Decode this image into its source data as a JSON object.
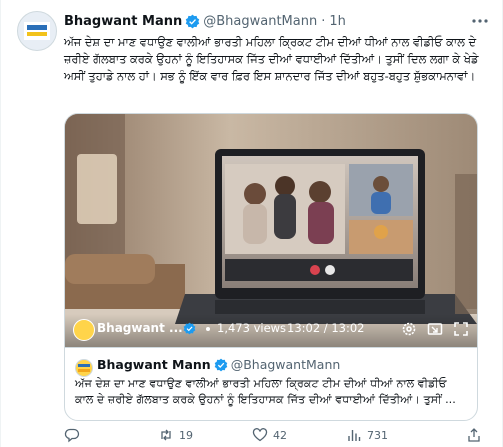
{
  "tweet": {
    "author_name": "Bhagwant Mann",
    "handle": "@BhagwantMann",
    "separator": "·",
    "time": "1h",
    "text": "ਅੱਜ ਦੇਸ਼ ਦਾ ਮਾਣ ਵਧਾਉਣ ਵਾਲੀਆਂ ਭਾਰਤੀ ਮਹਿਲਾ ਕ੍ਰਿਕਟ ਟੀਮ ਦੀਆਂ ਧੀਆਂ ਨਾਲ ਵੀਡੀਓ ਕਾਲ ਦੇ ਜ਼ਰੀਏ ਗੱਲਬਾਤ ਕਰਕੇ ਉਹਨਾਂ ਨੂੰ ਇਤਿਹਾਸਕ ਜਿੱਤ ਦੀਆਂ ਵਧਾਈਆਂ ਦਿੱਤੀਆਂ। ਤੁਸੀਂ ਦਿਲ ਲਗਾ ਕੇ ਖੇਡੇ ਅਸੀਂ ਤੁਹਾਡੇ ਨਾਲ ਹਾਂ। ਸਭ ਨੂੰ ਇੱਕ ਵਾਰ ਫ਼ਿਰ ਇਸ ਸ਼ਾਨਦਾਰ ਜਿੱਤ ਦੀਆਂ ਬਹੁਤ-ਬਹੁਤ ਸ਼ੁੱਭਕਾਮਨਾਵਾਂ।"
  },
  "video": {
    "channel_name": "Bhagwant ...",
    "views": "1,473 views",
    "time": "13:02 / 13:02"
  },
  "quote": {
    "author_name": "Bhagwant Mann",
    "handle": "@BhagwantMann",
    "text": "ਅੱਜ ਦੇਸ਼ ਦਾ ਮਾਣ ਵਧਾਉਣ ਵਾਲੀਆਂ ਭਾਰਤੀ ਮਹਿਲਾ ਕ੍ਰਿਕਟ ਟੀਮ ਦੀਆਂ ਧੀਆਂ ਨਾਲ ਵੀਡੀਓ ਕਾਲ ਦੇ ਜ਼ਰੀਏ ਗੱਲਬਾਤ ਕਰਕੇ ਉਹਨਾਂ ਨੂੰ ਇਤਿਹਾਸਕ ਜਿੱਤ ਦੀਆਂ ਵਧਾਈਆਂ ਦਿੱਤੀਆਂ। ਤੁਸੀਂ ..."
  },
  "actions": {
    "reply_count": "",
    "retweet_count": "19",
    "like_count": "42",
    "view_count": "731"
  },
  "icons": {
    "verified": "verified-badge-icon",
    "more": "more-icon",
    "reply": "reply-icon",
    "retweet": "retweet-icon",
    "like": "heart-icon",
    "views": "bar-chart-icon",
    "share": "share-icon",
    "settings": "gear-icon",
    "pip": "pip-icon",
    "fullscreen": "fullscreen-icon"
  },
  "colors": {
    "accent": "#1d9bf0",
    "text": "#0f1419",
    "secondary": "#536471",
    "border": "#cfd9de"
  }
}
